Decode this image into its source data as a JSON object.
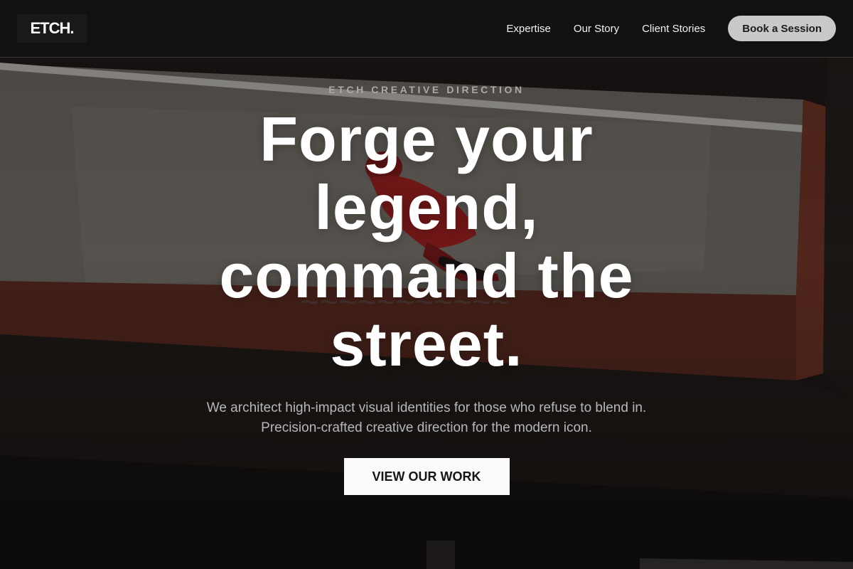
{
  "nav": {
    "brand": "ETCH",
    "brand_dot": ".",
    "links": [
      "Expertise",
      "Our Story",
      "Client Stories"
    ],
    "cta": "Book a Session"
  },
  "hero": {
    "eyebrow": "ETCH CREATIVE DIRECTION",
    "headline_lines": [
      "Forge your",
      "legend,",
      "command the",
      "street."
    ],
    "subtext_lines": [
      "We architect high-impact visual identities for those who refuse to blend in.",
      "Precision-crafted creative direction for the modern icon."
    ],
    "primary_button": "VIEW OUR WORK"
  },
  "colors": {
    "nav_bg": "#121111",
    "cta_pill_bg": "#c9c9c9",
    "accent_rust": "#4a231b",
    "button_bg": "#fbfbfb",
    "subtext": "#b6b6bd"
  },
  "icons": {
    "hero_image": "skateboarder-photo"
  }
}
